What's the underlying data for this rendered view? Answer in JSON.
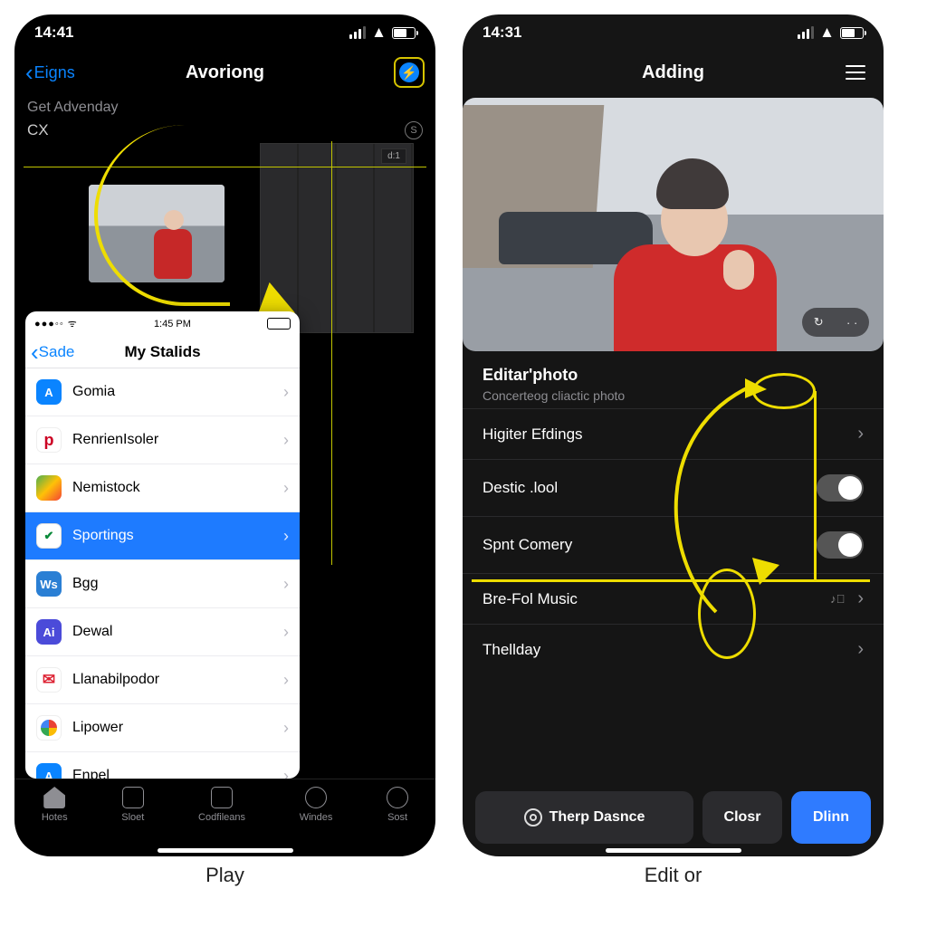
{
  "left": {
    "status_time": "14:41",
    "nav_back": "Eigns",
    "nav_title": "Avoriong",
    "sub_head": "Get Advenday",
    "cx_label": "CX",
    "tl_tag": "d:1",
    "sheet": {
      "status_time": "1:45 PM",
      "back": "Sade",
      "title": "My Stalids",
      "rows": [
        {
          "label": "Gomia",
          "icon": "as",
          "txt": "A"
        },
        {
          "label": "RenrienIsoler",
          "icon": "pi",
          "txt": "p"
        },
        {
          "label": "Nemistock",
          "icon": "ne",
          "txt": ""
        },
        {
          "label": "Sportings",
          "icon": "sp",
          "txt": "✔",
          "selected": true
        },
        {
          "label": "Bgg",
          "icon": "ws",
          "txt": "Ws"
        },
        {
          "label": "Dewal",
          "icon": "ai",
          "txt": "Ai"
        },
        {
          "label": "Llanabilpodor",
          "icon": "gm",
          "txt": "✉"
        },
        {
          "label": "Lipower",
          "icon": "ch",
          "txt": ""
        },
        {
          "label": "Enpel",
          "icon": "as",
          "txt": "A"
        }
      ]
    },
    "tabs": [
      "Hotes",
      "Sloet",
      "Codfileans",
      "Windes",
      "Sost"
    ],
    "caption": "Play"
  },
  "right": {
    "status_time": "14:31",
    "nav_title": "Adding",
    "pill_a": "↻",
    "pill_b": "· ·",
    "section_title": "Editar'photo",
    "section_sub": "Concerteog cliactic photo",
    "opts": [
      {
        "label": "Higiter Efdings",
        "kind": "chev"
      },
      {
        "label": "Destic .lool",
        "kind": "toggle"
      },
      {
        "label": "Spnt Comery",
        "kind": "toggle"
      },
      {
        "label": "Bre-Fol Music",
        "kind": "iconchev"
      },
      {
        "label": "Thellday",
        "kind": "chev"
      }
    ],
    "bottom": {
      "settings": "Therp Dasnce",
      "close": "Closr",
      "done": "Dlinn"
    },
    "caption": "Edit or"
  }
}
